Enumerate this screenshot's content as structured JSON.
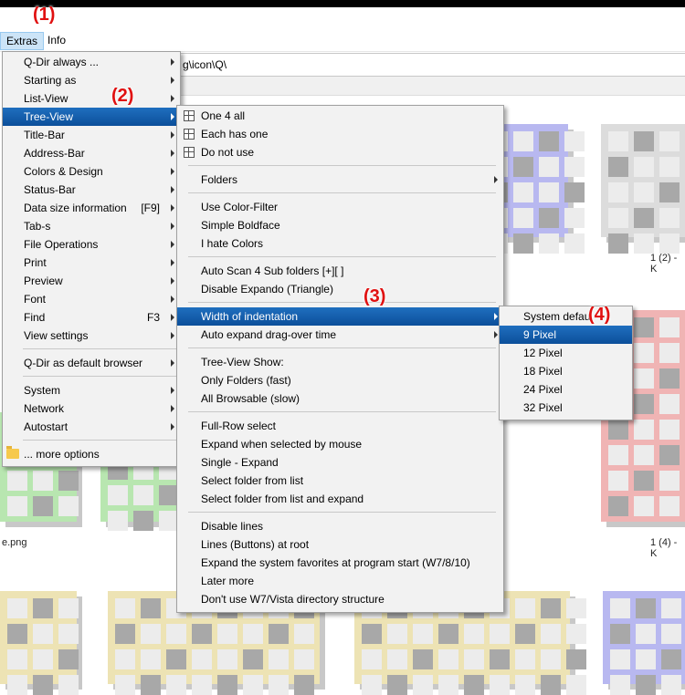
{
  "menubar": {
    "extras": "Extras",
    "info": "Info"
  },
  "address": {
    "path": "g\\icon\\Q\\"
  },
  "files": {
    "caption_1": "1 (2) - K",
    "caption_2": "e.png",
    "caption_3": "1 (4) - K"
  },
  "markers": [
    "(1)",
    "(2)",
    "(3)",
    "(4)"
  ],
  "extras_menu": [
    {
      "label": "Q-Dir always ...",
      "arrow": true
    },
    {
      "label": "Starting as",
      "arrow": true
    },
    {
      "label": "List-View",
      "arrow": true
    },
    {
      "label": "Tree-View",
      "arrow": true,
      "highlight": true
    },
    {
      "label": "Title-Bar",
      "arrow": true
    },
    {
      "label": "Address-Bar",
      "arrow": true
    },
    {
      "label": "Colors & Design",
      "arrow": true
    },
    {
      "label": "Status-Bar",
      "arrow": true
    },
    {
      "label": "Data size information",
      "shortcut": "[F9]",
      "arrow": true
    },
    {
      "label": "Tab-s",
      "arrow": true
    },
    {
      "label": "File Operations",
      "arrow": true
    },
    {
      "label": "Print",
      "arrow": true
    },
    {
      "label": "Preview",
      "arrow": true
    },
    {
      "label": "Font",
      "arrow": true
    },
    {
      "label": "Find",
      "shortcut": "F3",
      "arrow": true
    },
    {
      "label": "View settings",
      "arrow": true
    },
    {
      "sep": true
    },
    {
      "label": "Q-Dir as default browser",
      "arrow": true
    },
    {
      "sep": true
    },
    {
      "label": "System",
      "arrow": true
    },
    {
      "label": "Network",
      "arrow": true
    },
    {
      "label": "Autostart",
      "arrow": true
    },
    {
      "sep": true
    },
    {
      "label": "... more options",
      "icon": "folder-icon"
    }
  ],
  "treeview_menu": [
    {
      "label": "One 4 all",
      "icon": "grid-icon"
    },
    {
      "label": "Each has one",
      "icon": "grid-icon"
    },
    {
      "label": "Do not use",
      "icon": "grid-icon"
    },
    {
      "sep": true
    },
    {
      "label": "Folders",
      "arrow": true
    },
    {
      "sep": true
    },
    {
      "label": "Use Color-Filter"
    },
    {
      "label": "Simple Boldface"
    },
    {
      "label": "I hate Colors"
    },
    {
      "sep": true
    },
    {
      "label": "Auto Scan 4 Sub folders  [+][ ]"
    },
    {
      "label": "Disable Expando (Triangle)"
    },
    {
      "sep": true
    },
    {
      "label": "Width of indentation",
      "arrow": true,
      "highlight": true
    },
    {
      "label": "Auto expand drag-over time",
      "arrow": true
    },
    {
      "sep": true
    },
    {
      "label": "Tree-View Show:"
    },
    {
      "label": "Only Folders (fast)"
    },
    {
      "label": "All Browsable (slow)"
    },
    {
      "sep": true
    },
    {
      "label": "Full-Row select"
    },
    {
      "label": "Expand when selected by mouse"
    },
    {
      "label": "Single - Expand"
    },
    {
      "label": "Select folder from list"
    },
    {
      "label": "Select folder from list and expand"
    },
    {
      "sep": true
    },
    {
      "label": "Disable lines"
    },
    {
      "label": "Lines (Buttons) at root"
    },
    {
      "label": "Expand the system favorites at program start (W7/8/10)"
    },
    {
      "label": "Later more"
    },
    {
      "label": "Don't use W7/Vista directory structure"
    }
  ],
  "indent_menu": [
    {
      "label": "System defau"
    },
    {
      "label": "9 Pixel",
      "highlight": true
    },
    {
      "label": "12 Pixel"
    },
    {
      "label": "18 Pixel"
    },
    {
      "label": "24 Pixel"
    },
    {
      "label": "32 Pixel"
    }
  ],
  "colors": {
    "highlight": "#0c4f9a",
    "marker": "#e01010",
    "purple": "#b8b8f0",
    "green": "#b8e6b0",
    "red": "#f0b4b4",
    "yellow": "#ede3b4",
    "gray": "#dcdcdc"
  }
}
